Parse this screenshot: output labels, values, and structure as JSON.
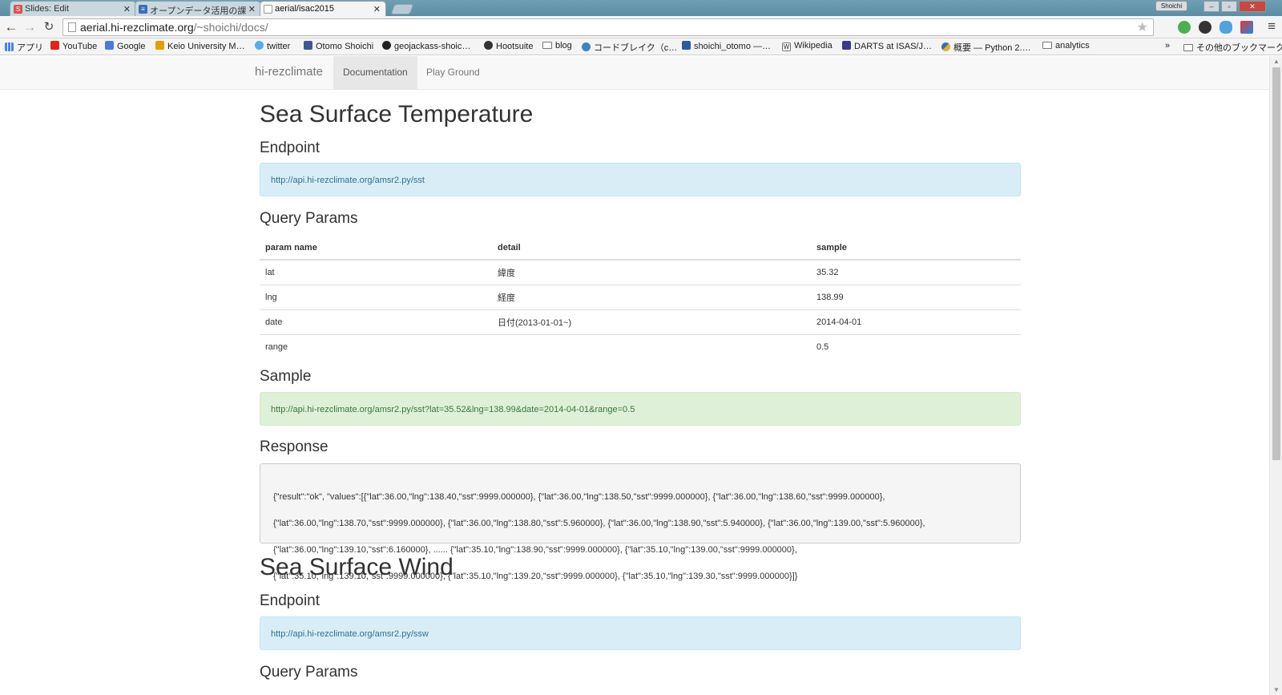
{
  "browser": {
    "tabs": [
      {
        "title": "Slides: Edit",
        "favicon_color": "#d9534f",
        "favicon_letter": "S"
      },
      {
        "title": "オープンデータ活用の課",
        "favicon_color": "#3b6fb6",
        "favicon_letter": "≡"
      },
      {
        "title": "aerial/isac2015",
        "favicon_color": "#ffffff",
        "favicon_letter": ""
      }
    ],
    "profile_name": "Shoichi",
    "url_host": "aerial.hi-rezclimate.org",
    "url_path": "/~shoichi/docs/",
    "bookmarks": [
      {
        "label": "アプリ",
        "icon_color": "#4285f4"
      },
      {
        "label": "YouTube",
        "icon_color": "#e62117"
      },
      {
        "label": "Google",
        "icon_color": "#4a7ae0"
      },
      {
        "label": "Keio University M…",
        "icon_color": "#e0a100"
      },
      {
        "label": "twitter",
        "icon_color": "#55acee"
      },
      {
        "label": "Otomo Shoichi",
        "icon_color": "#3b5998"
      },
      {
        "label": "geojackass-shoic…",
        "icon_color": "#222222"
      },
      {
        "label": "Hootsuite",
        "icon_color": "#333333"
      },
      {
        "label": "blog",
        "icon_color": "folder"
      },
      {
        "label": "コードブレイク（c…",
        "icon_color": "#3a84c6"
      },
      {
        "label": "shoichi_otomo —…",
        "icon_color": "#2c5aa0"
      },
      {
        "label": "Wikipedia",
        "icon_color": "#777777"
      },
      {
        "label": "DARTS at ISAS/J…",
        "icon_color": "#3a3a8c"
      },
      {
        "label": "概要 — Python 2.…",
        "icon_color": "#e5b22e"
      },
      {
        "label": "analytics",
        "icon_color": "folder"
      }
    ],
    "bookmarks_overflow": "»",
    "other_bookmarks": "その他のブックマーク"
  },
  "nav": {
    "brand": "hi-rezclimate",
    "links": [
      "Documentation",
      "Play Ground"
    ]
  },
  "sst": {
    "title": "Sea Surface Temperature",
    "endpoint_heading": "Endpoint",
    "endpoint_url": "http://api.hi-rezclimate.org/amsr2.py/sst",
    "params_heading": "Query Params",
    "table_headers": [
      "param name",
      "detail",
      "sample"
    ],
    "rows": [
      {
        "name": "lat",
        "detail": "緯度",
        "sample": "35.32"
      },
      {
        "name": "lng",
        "detail": "経度",
        "sample": "138.99"
      },
      {
        "name": "date",
        "detail": "日付(2013-01-01~)",
        "sample": "2014-04-01"
      },
      {
        "name": "range",
        "detail": "",
        "sample": "0.5"
      }
    ],
    "sample_heading": "Sample",
    "sample_url": "http://api.hi-rezclimate.org/amsr2.py/sst?lat=35.52&lng=138.99&date=2014-04-01&range=0.5",
    "response_heading": "Response",
    "response_lines": [
      "{\"result\":\"ok\", \"values\":[{\"lat\":36.00,\"lng\":138.40,\"sst\":9999.000000}, {\"lat\":36.00,\"lng\":138.50,\"sst\":9999.000000}, {\"lat\":36.00,\"lng\":138.60,\"sst\":9999.000000},",
      "{\"lat\":36.00,\"lng\":138.70,\"sst\":9999.000000}, {\"lat\":36.00,\"lng\":138.80,\"sst\":5.960000}, {\"lat\":36.00,\"lng\":138.90,\"sst\":5.940000}, {\"lat\":36.00,\"lng\":139.00,\"sst\":5.960000},",
      "{\"lat\":36.00,\"lng\":139.10,\"sst\":6.160000}, ...... {\"lat\":35.10,\"lng\":138.90,\"sst\":9999.000000}, {\"lat\":35.10,\"lng\":139.00,\"sst\":9999.000000},",
      "{\"lat\":35.10,\"lng\":139.10,\"sst\":9999.000000}, {\"lat\":35.10,\"lng\":139.20,\"sst\":9999.000000}, {\"lat\":35.10,\"lng\":139.30,\"sst\":9999.000000}]}"
    ]
  },
  "ssw": {
    "title": "Sea Surface Wind",
    "endpoint_heading": "Endpoint",
    "endpoint_url": "http://api.hi-rezclimate.org/amsr2.py/ssw",
    "params_heading": "Query Params"
  }
}
